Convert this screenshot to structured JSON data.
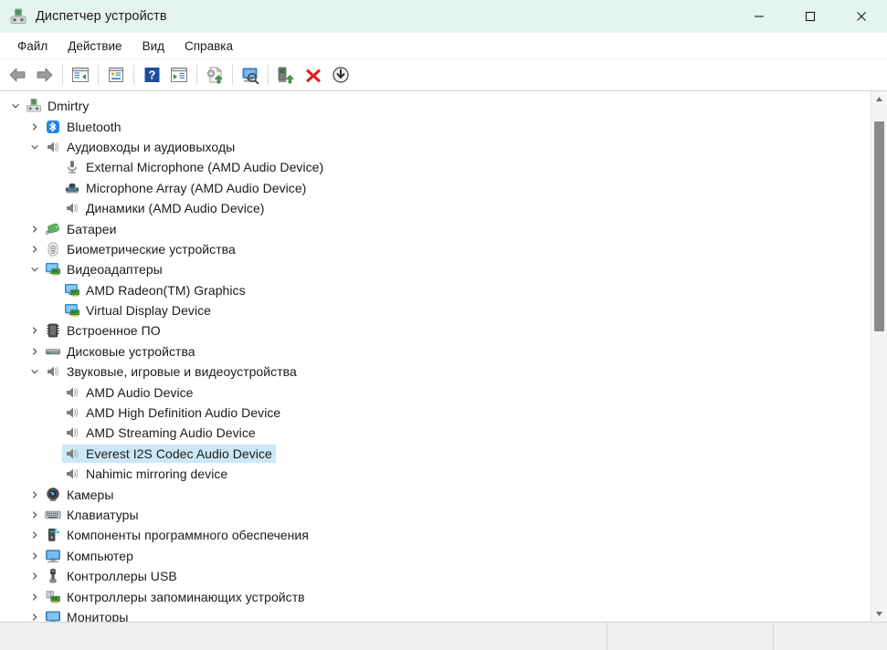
{
  "window": {
    "title": "Диспетчер устройств",
    "icon": "device-manager-icon",
    "titlebar_color": "#e6f4ee",
    "controls": {
      "minimize": "—",
      "maximize": "□",
      "close": "✕"
    }
  },
  "menubar": {
    "items": [
      {
        "label": "Файл",
        "name": "menu-file"
      },
      {
        "label": "Действие",
        "name": "menu-action"
      },
      {
        "label": "Вид",
        "name": "menu-view"
      },
      {
        "label": "Справка",
        "name": "menu-help"
      }
    ]
  },
  "toolbar": {
    "buttons": [
      {
        "name": "back-icon",
        "tip": "Назад"
      },
      {
        "name": "forward-icon",
        "tip": "Вперед"
      },
      {
        "separator": true
      },
      {
        "name": "show-hide-console-tree-icon",
        "tip": "Показать/скрыть дерево консоли"
      },
      {
        "separator": true
      },
      {
        "name": "properties-icon",
        "tip": "Свойства"
      },
      {
        "separator": true
      },
      {
        "name": "help-icon",
        "tip": "Справка"
      },
      {
        "name": "action-menu-icon",
        "tip": "Меню действий"
      },
      {
        "separator": true
      },
      {
        "name": "update-driver-icon",
        "tip": "Обновить драйвер"
      },
      {
        "separator": true
      },
      {
        "name": "scan-hardware-changes-icon",
        "tip": "Обновить конфигурацию оборудования"
      },
      {
        "separator": true
      },
      {
        "name": "enable-device-icon",
        "tip": "Включить устройство"
      },
      {
        "name": "uninstall-device-icon",
        "tip": "Удалить устройство"
      },
      {
        "name": "disable-device-icon",
        "tip": "Отключить устройство"
      }
    ]
  },
  "tree": {
    "nodes": [
      {
        "label": "Dmirtry",
        "indent": 0,
        "state": "expanded",
        "icon": "computer-root-icon",
        "selected": false
      },
      {
        "label": "Bluetooth",
        "indent": 1,
        "state": "collapsed",
        "icon": "bluetooth-icon",
        "selected": false
      },
      {
        "label": "Аудиовходы и аудиовыходы",
        "indent": 1,
        "state": "expanded",
        "icon": "audio-io-icon",
        "selected": false
      },
      {
        "label": "External Microphone (AMD Audio Device)",
        "indent": 2,
        "state": "leaf",
        "icon": "microphone-icon",
        "selected": false
      },
      {
        "label": "Microphone Array (AMD Audio Device)",
        "indent": 2,
        "state": "leaf",
        "icon": "microphone-array-icon",
        "selected": false
      },
      {
        "label": "Динамики (AMD Audio Device)",
        "indent": 2,
        "state": "leaf",
        "icon": "speaker-icon",
        "selected": false
      },
      {
        "label": "Батареи",
        "indent": 1,
        "state": "collapsed",
        "icon": "battery-icon",
        "selected": false
      },
      {
        "label": "Биометрические устройства",
        "indent": 1,
        "state": "collapsed",
        "icon": "fingerprint-icon",
        "selected": false
      },
      {
        "label": "Видеоадаптеры",
        "indent": 1,
        "state": "expanded",
        "icon": "display-adapter-icon",
        "selected": false
      },
      {
        "label": "AMD Radeon(TM) Graphics",
        "indent": 2,
        "state": "leaf",
        "icon": "display-adapter-icon",
        "selected": false
      },
      {
        "label": "Virtual Display Device",
        "indent": 2,
        "state": "leaf",
        "icon": "display-adapter-icon",
        "selected": false
      },
      {
        "label": "Встроенное ПО",
        "indent": 1,
        "state": "collapsed",
        "icon": "firmware-icon",
        "selected": false
      },
      {
        "label": "Дисковые устройства",
        "indent": 1,
        "state": "collapsed",
        "icon": "disk-drive-icon",
        "selected": false
      },
      {
        "label": "Звуковые, игровые и видеоустройства",
        "indent": 1,
        "state": "expanded",
        "icon": "speaker-icon",
        "selected": false
      },
      {
        "label": "AMD Audio Device",
        "indent": 2,
        "state": "leaf",
        "icon": "speaker-icon",
        "selected": false
      },
      {
        "label": "AMD High Definition Audio Device",
        "indent": 2,
        "state": "leaf",
        "icon": "speaker-icon",
        "selected": false
      },
      {
        "label": "AMD Streaming Audio Device",
        "indent": 2,
        "state": "leaf",
        "icon": "speaker-icon",
        "selected": false
      },
      {
        "label": "Everest I2S Codec Audio Device",
        "indent": 2,
        "state": "leaf",
        "icon": "speaker-icon",
        "selected": true
      },
      {
        "label": "Nahimic mirroring device",
        "indent": 2,
        "state": "leaf",
        "icon": "speaker-icon",
        "selected": false
      },
      {
        "label": "Камеры",
        "indent": 1,
        "state": "collapsed",
        "icon": "camera-icon",
        "selected": false
      },
      {
        "label": "Клавиатуры",
        "indent": 1,
        "state": "collapsed",
        "icon": "keyboard-icon",
        "selected": false
      },
      {
        "label": "Компоненты программного обеспечения",
        "indent": 1,
        "state": "collapsed",
        "icon": "software-component-icon",
        "selected": false
      },
      {
        "label": "Компьютер",
        "indent": 1,
        "state": "collapsed",
        "icon": "computer-icon",
        "selected": false
      },
      {
        "label": "Контроллеры USB",
        "indent": 1,
        "state": "collapsed",
        "icon": "usb-icon",
        "selected": false
      },
      {
        "label": "Контроллеры запоминающих устройств",
        "indent": 1,
        "state": "collapsed",
        "icon": "storage-controller-icon",
        "selected": false
      },
      {
        "label": "Мониторы",
        "indent": 1,
        "state": "collapsed",
        "icon": "monitor-icon",
        "selected": false
      }
    ],
    "selection_color": "#cce8f7"
  },
  "scrollbar": {
    "up_arrow": "▲",
    "down_arrow": "▼",
    "thumb_top_pct": 3,
    "thumb_height_pct": 42
  },
  "statusbar": {
    "pane1": "",
    "pane2": "",
    "pane3": ""
  }
}
